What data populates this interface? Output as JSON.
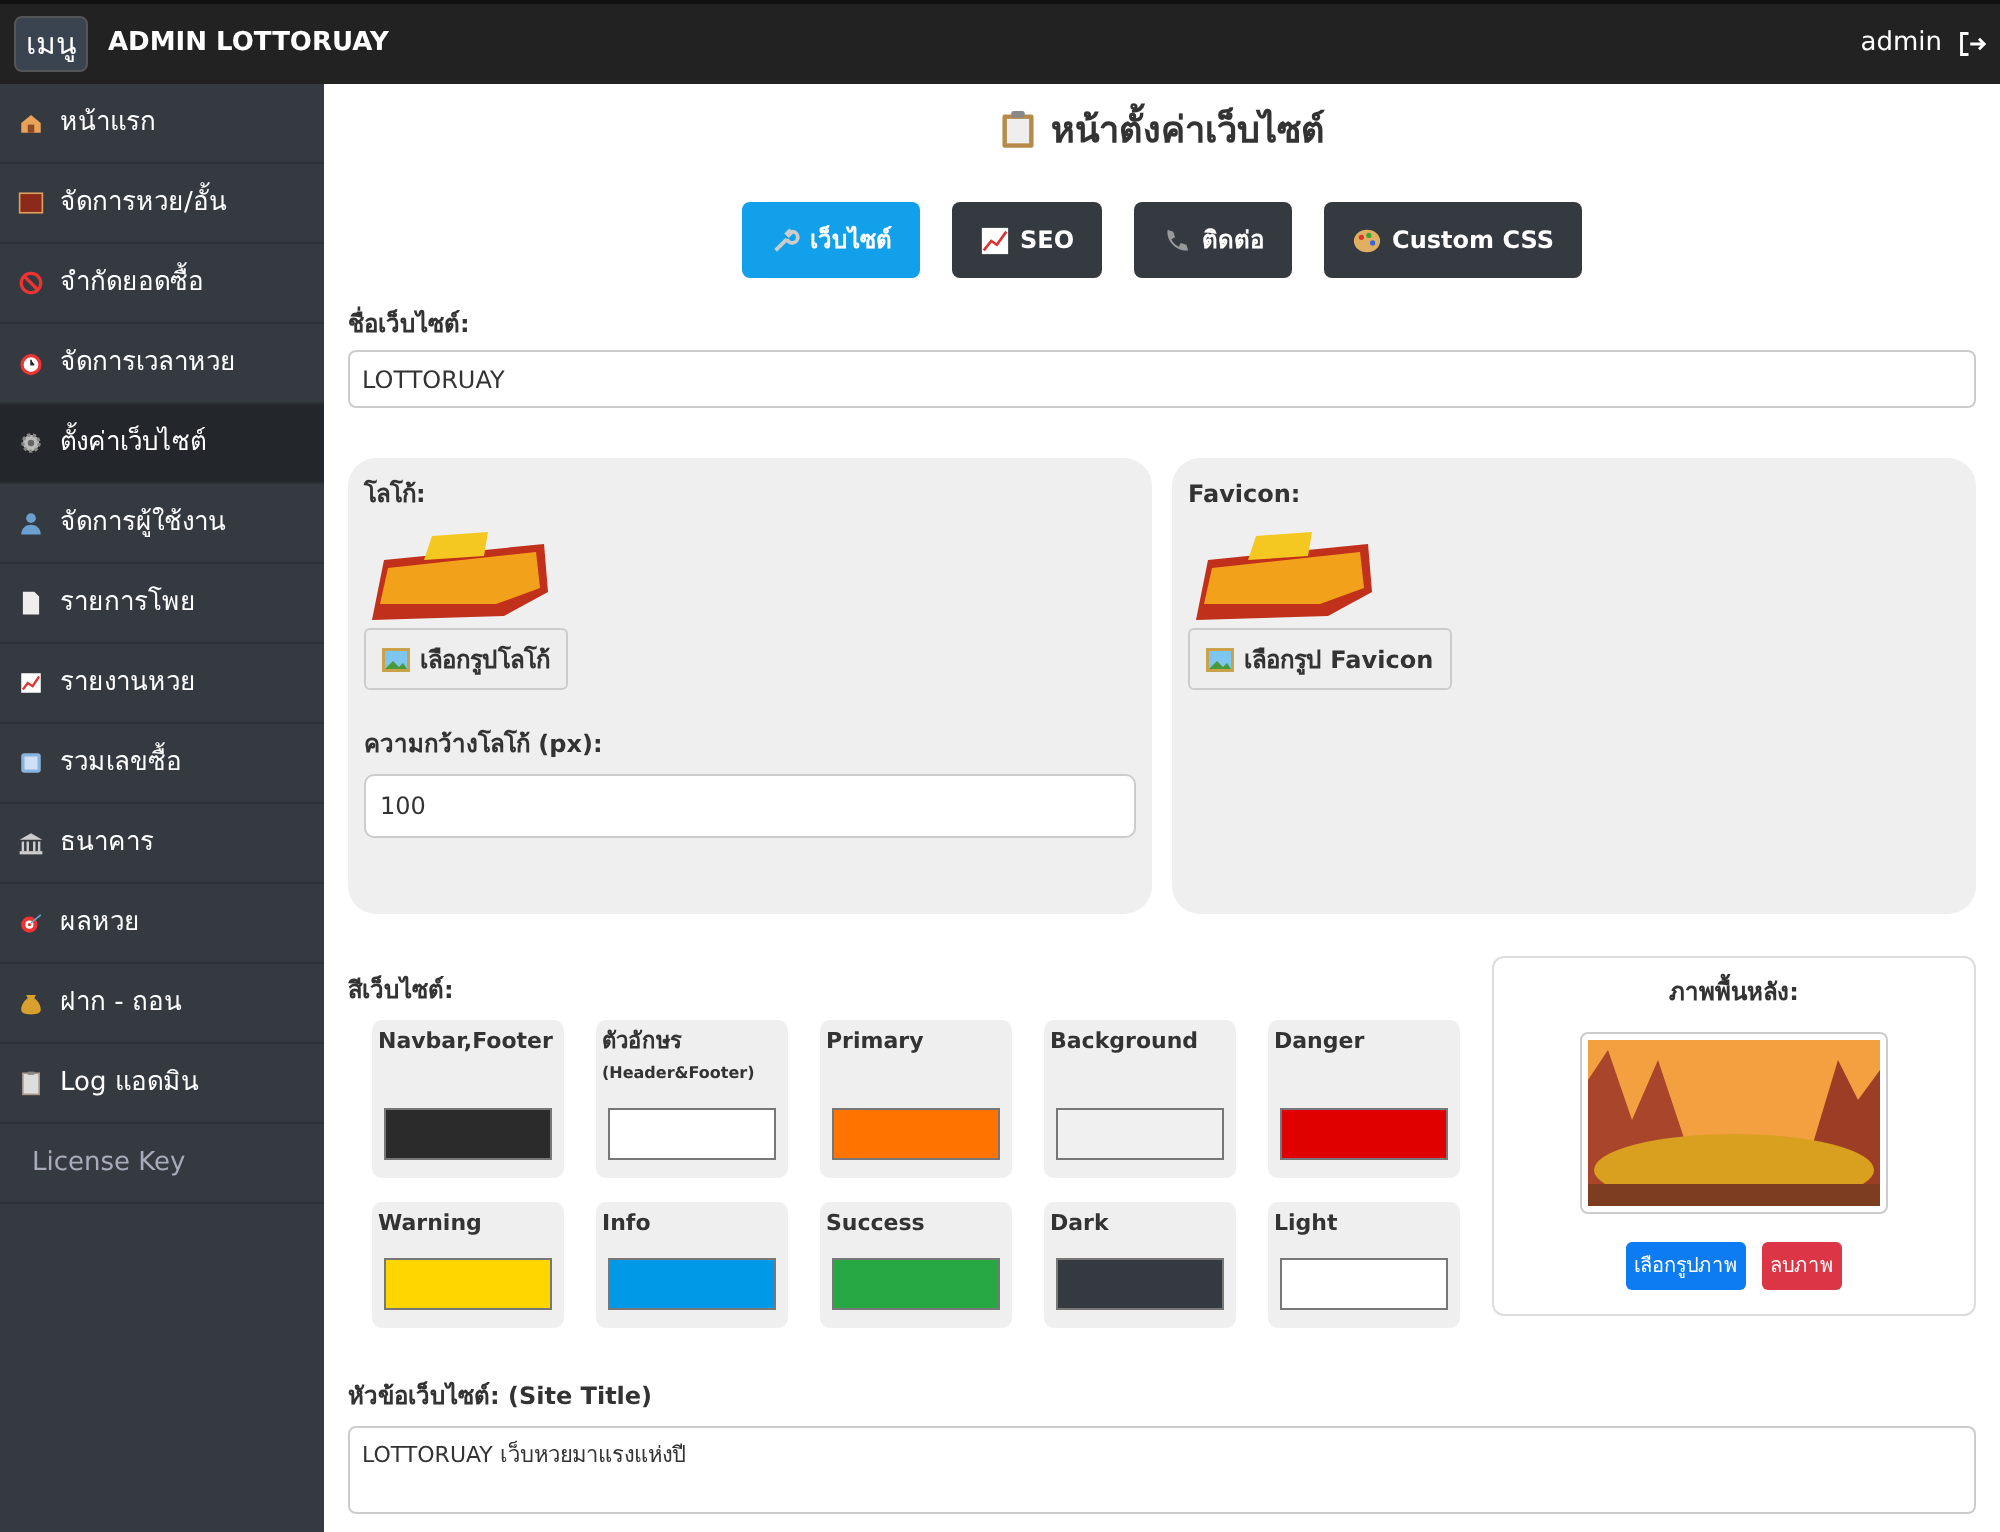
{
  "header": {
    "menu_button": "เมนู",
    "brand": "ADMIN LOTTORUAY",
    "user": "admin"
  },
  "sidebar": {
    "items": [
      {
        "label": "หน้าแรก",
        "kind": "icon",
        "selected": false
      },
      {
        "label": "จัดการหวย/อั้น",
        "kind": "icon",
        "selected": false
      },
      {
        "label": "จำกัดยอดซื้อ",
        "kind": "icon",
        "selected": false
      },
      {
        "label": "จัดการเวลาหวย",
        "kind": "icon",
        "selected": false
      },
      {
        "label": "ตั้งค่าเว็บไซต์",
        "kind": "icon",
        "selected": true
      },
      {
        "label": "จัดการผู้ใช้งาน",
        "kind": "icon",
        "selected": false
      },
      {
        "label": "รายการโพย",
        "kind": "icon",
        "selected": false
      },
      {
        "label": "รายงานหวย",
        "kind": "icon",
        "selected": false
      },
      {
        "label": "รวมเลขซื้อ",
        "kind": "icon",
        "selected": false
      },
      {
        "label": "ธนาคาร",
        "kind": "icon",
        "selected": false
      },
      {
        "label": "ผลหวย",
        "kind": "icon",
        "selected": false
      },
      {
        "label": "ฝาก - ถอน",
        "kind": "icon",
        "selected": false
      },
      {
        "label": "Log แอดมิน",
        "kind": "icon",
        "selected": false
      },
      {
        "label": "License Key",
        "kind": "plain",
        "selected": false
      }
    ]
  },
  "page_title": "หน้าตั้งค่าเว็บไซต์",
  "tabs": [
    {
      "label": "เว็บไซต์",
      "selected": true
    },
    {
      "label": "SEO",
      "selected": false
    },
    {
      "label": "ติดต่อ",
      "selected": false
    },
    {
      "label": "Custom CSS",
      "selected": false
    }
  ],
  "site_name": {
    "label": "ชื่อเว็บไซต์:",
    "value": "LOTTORUAY"
  },
  "logo_panel": {
    "label": "โลโก้:",
    "button": "เลือกรูปโลโก้",
    "width_label": "ความกว้างโลโก้ (px):",
    "width_value": "100"
  },
  "favicon_panel": {
    "label": "Favicon:",
    "button": "เลือกรูป Favicon"
  },
  "colors": {
    "label": "สีเว็บไซต์:",
    "items": [
      {
        "name": "Navbar,Footer",
        "color": "#2b2b2b"
      },
      {
        "name": "ตัวอักษร",
        "note": "(Header&Footer)",
        "color": "#ffffff"
      },
      {
        "name": "Primary",
        "color": "#ff7300"
      },
      {
        "name": "Background",
        "color": "#f0f0f0"
      },
      {
        "name": "Danger",
        "color": "#e00000"
      },
      {
        "name": "Warning",
        "color": "#ffd600"
      },
      {
        "name": "Info",
        "color": "#0099e8"
      },
      {
        "name": "Success",
        "color": "#28a745"
      },
      {
        "name": "Dark",
        "color": "#343a40"
      },
      {
        "name": "Light",
        "color": "#ffffff"
      }
    ]
  },
  "background_card": {
    "title": "ภาพพื้นหลัง:",
    "choose_button": "เลือกรูปภาพ",
    "delete_button": "ลบภาพ"
  },
  "site_title": {
    "label": "หัวข้อเว็บไซต์: (Site Title)",
    "value": "LOTTORUAY เว็บหวยมาแรงแห่งปี"
  }
}
